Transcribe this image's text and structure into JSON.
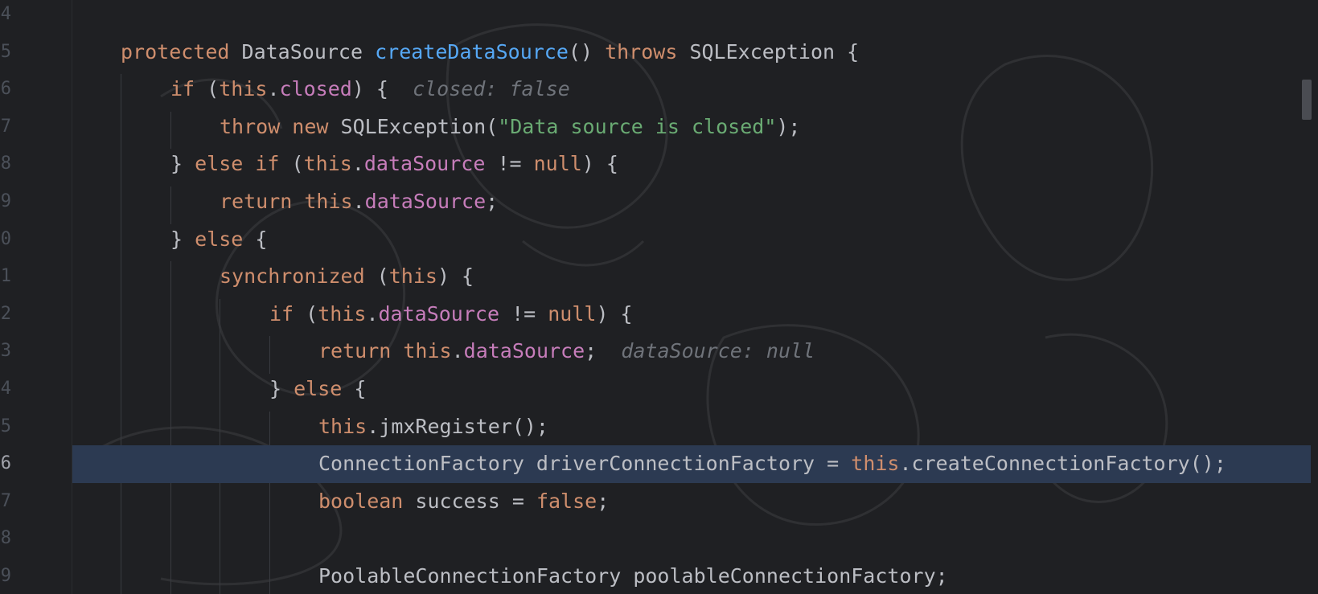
{
  "editor": {
    "line_numbers": [
      "4",
      "5",
      "6",
      "7",
      "8",
      "9",
      "0",
      "1",
      "2",
      "3",
      "4",
      "5",
      "6",
      "7",
      "8",
      "9"
    ],
    "current_line_index": 12,
    "lines": [
      [],
      [
        [
          "kw",
          "protected "
        ],
        [
          "t",
          "DataSource "
        ],
        [
          "fn",
          "createDataSource"
        ],
        [
          "t",
          "() "
        ],
        [
          "kw",
          "throws "
        ],
        [
          "t",
          "SQLException {"
        ]
      ],
      [
        [
          "kw",
          "if "
        ],
        [
          "t",
          "("
        ],
        [
          "kw",
          "this"
        ],
        [
          "t",
          "."
        ],
        [
          "fld",
          "closed"
        ],
        [
          "t",
          ") {  "
        ],
        [
          "hint",
          "closed: false"
        ]
      ],
      [
        [
          "kw",
          "throw new "
        ],
        [
          "t",
          "SQLException("
        ],
        [
          "str",
          "\"Data source is closed\""
        ],
        [
          "t",
          ");"
        ]
      ],
      [
        [
          "t",
          "} "
        ],
        [
          "kw",
          "else if "
        ],
        [
          "t",
          "("
        ],
        [
          "kw",
          "this"
        ],
        [
          "t",
          "."
        ],
        [
          "fld",
          "dataSource"
        ],
        [
          "t",
          " != "
        ],
        [
          "kw",
          "null"
        ],
        [
          "t",
          ") {"
        ]
      ],
      [
        [
          "kw",
          "return this"
        ],
        [
          "t",
          "."
        ],
        [
          "fld",
          "dataSource"
        ],
        [
          "t",
          ";"
        ]
      ],
      [
        [
          "t",
          "} "
        ],
        [
          "kw",
          "else "
        ],
        [
          "t",
          "{"
        ]
      ],
      [
        [
          "kw",
          "synchronized "
        ],
        [
          "t",
          "("
        ],
        [
          "kw",
          "this"
        ],
        [
          "t",
          ") {"
        ]
      ],
      [
        [
          "kw",
          "if "
        ],
        [
          "t",
          "("
        ],
        [
          "kw",
          "this"
        ],
        [
          "t",
          "."
        ],
        [
          "fld",
          "dataSource"
        ],
        [
          "t",
          " != "
        ],
        [
          "kw",
          "null"
        ],
        [
          "t",
          ") {"
        ]
      ],
      [
        [
          "kw",
          "return this"
        ],
        [
          "t",
          "."
        ],
        [
          "fld",
          "dataSource"
        ],
        [
          "t",
          ";  "
        ],
        [
          "hint",
          "dataSource: null"
        ]
      ],
      [
        [
          "t",
          "} "
        ],
        [
          "kw",
          "else "
        ],
        [
          "t",
          "{"
        ]
      ],
      [
        [
          "kw",
          "this"
        ],
        [
          "t",
          ".jmxRegister();"
        ]
      ],
      [
        [
          "t",
          "ConnectionFactory driverConnectionFactory = "
        ],
        [
          "kw",
          "this"
        ],
        [
          "t",
          ".createConnectionFactory();"
        ]
      ],
      [
        [
          "kw",
          "boolean "
        ],
        [
          "t",
          "success = "
        ],
        [
          "kw",
          "false"
        ],
        [
          "t",
          ";"
        ]
      ],
      [],
      [
        [
          "t",
          "PoolableConnectionFactory poolableConnectionFactory;"
        ]
      ]
    ],
    "indents": [
      0,
      150,
      212,
      273,
      212,
      273,
      212,
      273,
      335,
      396,
      335,
      396,
      396,
      396,
      396,
      396
    ]
  }
}
